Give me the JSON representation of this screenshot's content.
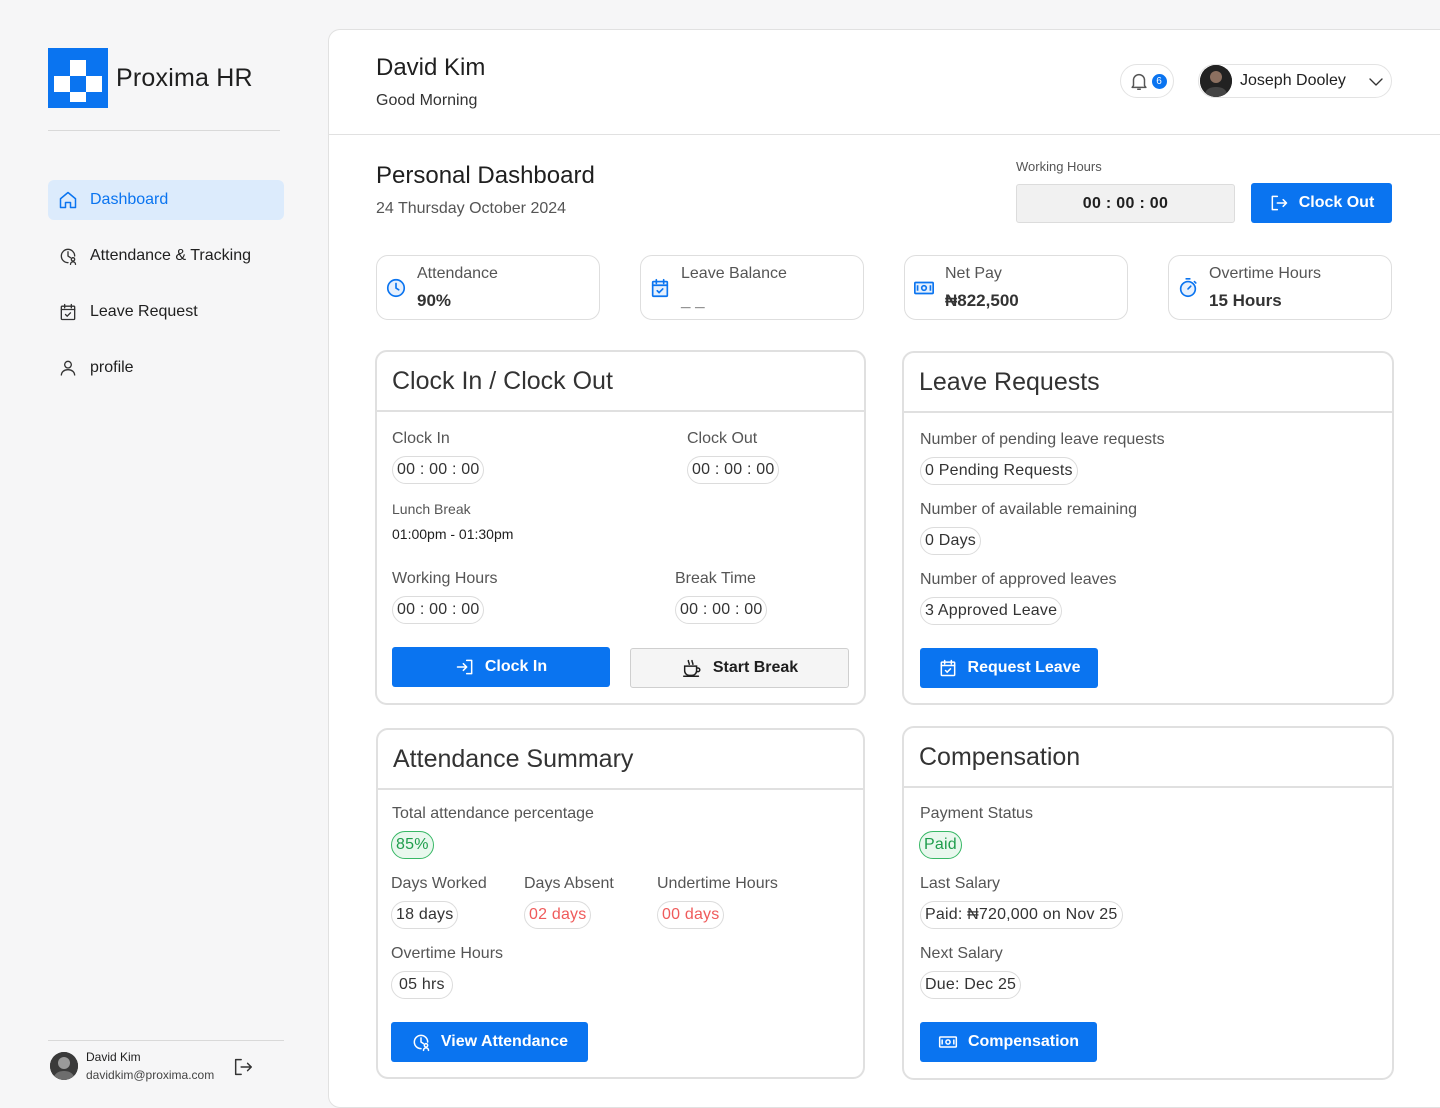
{
  "brand": {
    "name": "Proxima HR",
    "accent": "#0a74f0"
  },
  "sidebar": {
    "items": [
      {
        "label": "Dashboard",
        "icon": "home-icon",
        "active": true
      },
      {
        "label": "Attendance & Tracking",
        "icon": "clock-user-icon",
        "active": false
      },
      {
        "label": "Leave Request",
        "icon": "calendar-check-icon",
        "active": false
      },
      {
        "label": "profile",
        "icon": "user-icon",
        "active": false
      }
    ],
    "user": {
      "name": "David Kim",
      "email": "davidkim@proxima.com"
    }
  },
  "header": {
    "name": "David Kim",
    "greeting": "Good Morning",
    "notification_count": "6",
    "account_name": "Joseph Dooley"
  },
  "dashboard": {
    "title": "Personal Dashboard",
    "date": "24 Thursday October 2024",
    "working_hours_label": "Working Hours",
    "working_hours_value": "00 : 00 : 00",
    "clock_out_button": "Clock Out"
  },
  "stats": [
    {
      "label": "Attendance",
      "value": "90%",
      "icon": "clock-icon"
    },
    {
      "label": "Leave Balance",
      "value": "_ _",
      "icon": "calendar-check-icon"
    },
    {
      "label": "Net Pay",
      "value": "₦822,500",
      "icon": "money-icon"
    },
    {
      "label": "Overtime Hours",
      "value": "15 Hours",
      "icon": "stopwatch-icon"
    }
  ],
  "clock_card": {
    "title": "Clock In / Clock Out",
    "clock_in_label": "Clock In",
    "clock_in_value": "00 : 00 : 00",
    "clock_out_label": "Clock Out",
    "clock_out_value": "00 : 00 : 00",
    "lunch_label": "Lunch Break",
    "lunch_value": "01:00pm - 01:30pm",
    "working_hours_label": "Working Hours",
    "working_hours_value": "00 : 00 : 00",
    "break_time_label": "Break Time",
    "break_time_value": "00 : 00 : 00",
    "clock_in_button": "Clock In",
    "start_break_button": "Start Break"
  },
  "leave_card": {
    "title": "Leave Requests",
    "pending_label": "Number of pending leave requests",
    "pending_value": "0 Pending Requests",
    "available_label": "Number of available remaining",
    "available_value": "0 Days",
    "approved_label": "Number of approved leaves",
    "approved_value": "3 Approved Leave",
    "button": "Request Leave"
  },
  "attendance_card": {
    "title": "Attendance Summary",
    "total_label": "Total attendance percentage",
    "total_value": "85%",
    "worked_label": "Days Worked",
    "worked_value": "18 days",
    "absent_label": "Days Absent",
    "absent_value": "02 days",
    "undertime_label": "Undertime Hours",
    "undertime_value": "00 days",
    "overtime_label": "Overtime Hours",
    "overtime_value": "05 hrs",
    "button": "View Attendance"
  },
  "compensation_card": {
    "title": "Compensation",
    "status_label": "Payment Status",
    "status_value": "Paid",
    "last_label": "Last Salary",
    "last_value": "Paid: ₦720,000 on Nov 25",
    "next_label": "Next Salary",
    "next_value": "Due: Dec 25",
    "button": "Compensation"
  }
}
